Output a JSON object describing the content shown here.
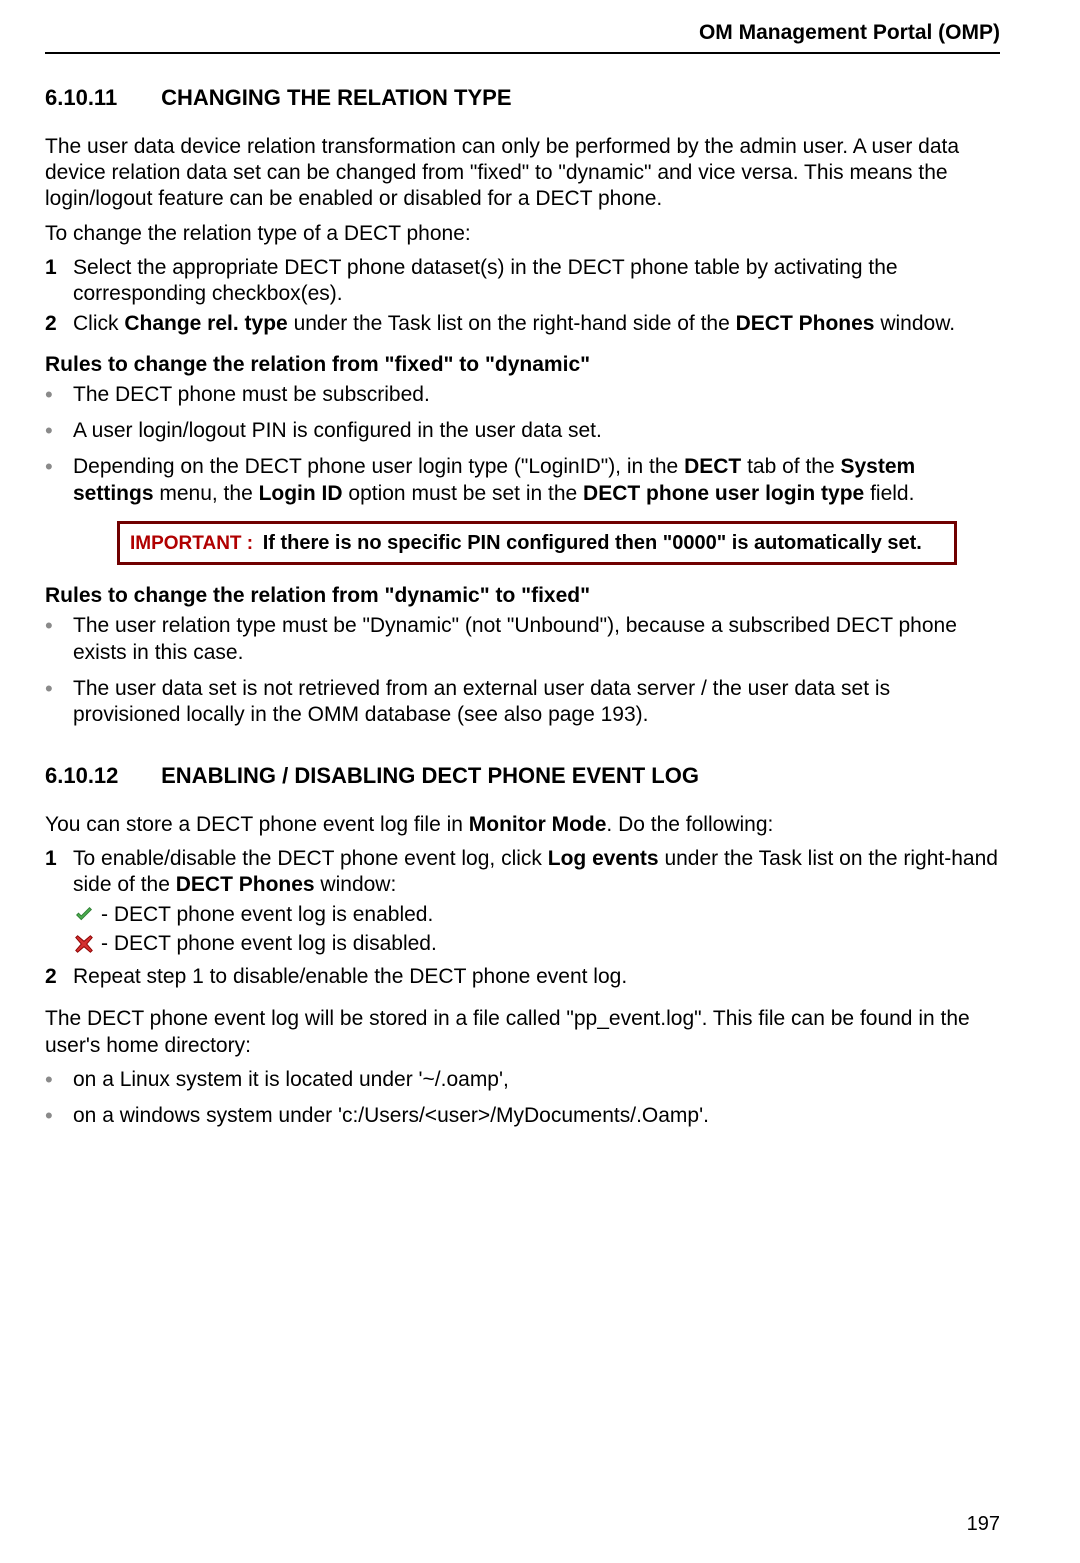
{
  "header": {
    "title": "OM Management Portal (OMP)"
  },
  "sec1": {
    "num": "6.10.11",
    "title": "CHANGING THE RELATION TYPE",
    "p1": "The user data device relation transformation can only be performed by the admin user. A user data device relation data set can be changed from \"fixed\" to \"dynamic\" and vice versa. This means the login/logout feature can be enabled or disabled for a DECT phone.",
    "p2": "To change the relation type of a DECT phone:",
    "step1": "Select the appropriate DECT phone dataset(s) in the DECT phone table by activating the corresponding checkbox(es).",
    "step2_a": "Click ",
    "step2_b": "Change rel. type",
    "step2_c": " under the Task list on the right-hand side of the ",
    "step2_d": "DECT Phones",
    "step2_e": " window.",
    "rulesA_title": "Rules to change the relation from \"fixed\" to \"dynamic\"",
    "rulesA_1": "The DECT phone must be subscribed.",
    "rulesA_2": "A user login/logout PIN is configured in the user data set.",
    "rulesA_3a": "Depending on the DECT phone user login type (\"LoginID\"), in the ",
    "rulesA_3b": "DECT",
    "rulesA_3c": " tab of the ",
    "rulesA_3d": "System settings",
    "rulesA_3e": " menu, the ",
    "rulesA_3f": "Login ID",
    "rulesA_3g": " option must be set in the ",
    "rulesA_3h": "DECT phone user login type",
    "rulesA_3i": " field.",
    "note_label": "IMPORTANT :",
    "note_text": " If there is no specific PIN configured then \"0000\" is automatically set.",
    "rulesB_title": "Rules to change the relation from \"dynamic\" to \"fixed\"",
    "rulesB_1": "The user relation type must be \"Dynamic\" (not \"Unbound\"), because a subscribed DECT phone exists in this case.",
    "rulesB_2": "The user data set is not retrieved from an external user data server / the user data set is provisioned locally in the OMM database (see also page 193)."
  },
  "sec2": {
    "num": "6.10.12",
    "title": "ENABLING / DISABLING DECT PHONE EVENT LOG",
    "p1a": "You can store a DECT phone event log file in ",
    "p1b": "Monitor Mode",
    "p1c": ". Do the following:",
    "step1_a": "To enable/disable the DECT phone event log, click ",
    "step1_b": "Log events",
    "step1_c": " under the Task list on the right-hand side of the ",
    "step1_d": "DECT Phones",
    "step1_e": " window:",
    "enabled_text": "- DECT phone event log is enabled.",
    "disabled_text": "- DECT phone event log is disabled.",
    "step2": "Repeat step 1 to disable/enable the DECT phone event log.",
    "p2": "The DECT phone event log will be stored in a file called \"pp_event.log\". This file can be found in the user's home directory:",
    "loc1": "on a Linux system it is located under '~/.oamp',",
    "loc2": "on a windows system under 'c:/Users/<user>/MyDocuments/.Oamp'."
  },
  "page_number": "197"
}
